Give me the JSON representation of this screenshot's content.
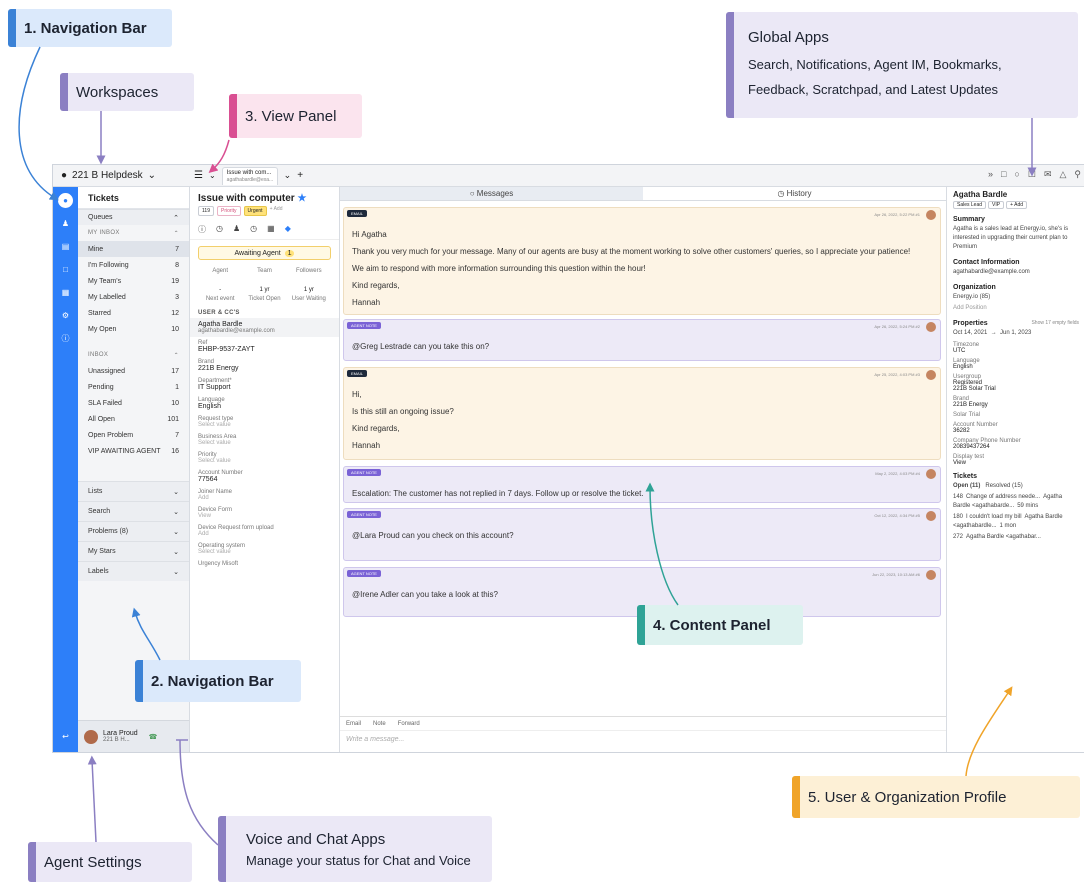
{
  "callouts": {
    "nav1": "1. Navigation Bar",
    "workspaces": "Workspaces",
    "view_panel": "3. View Panel",
    "global_title": "Global Apps",
    "global_desc1": "Search, Notifications, Agent IM, Bookmarks,",
    "global_desc2": "Feedback, Scratchpad, and Latest Updates",
    "nav2": "2. Navigation Bar",
    "content_panel": "4. Content Panel",
    "user_org": "5. User & Organization Profile",
    "agent_settings": "Agent Settings",
    "voice_title": "Voice and Chat Apps",
    "voice_desc": "Manage your status for Chat and Voice"
  },
  "app": {
    "workspace": "221 B Helpdesk",
    "tab_title": "Issue with com...",
    "tab_sub": "agathabardle@exa..."
  },
  "nav": {
    "header": "Tickets",
    "queues": "Queues",
    "my_inbox": "MY INBOX",
    "my_inbox_items": [
      {
        "label": "Mine",
        "count": "7"
      },
      {
        "label": "I'm Following",
        "count": "8"
      },
      {
        "label": "My Team's",
        "count": "19"
      },
      {
        "label": "My Labelled",
        "count": "3"
      },
      {
        "label": "Starred",
        "count": "12"
      },
      {
        "label": "My Open",
        "count": "10"
      }
    ],
    "inbox": "INBOX",
    "inbox_items": [
      {
        "label": "Unassigned",
        "count": "17"
      },
      {
        "label": "Pending",
        "count": "1"
      },
      {
        "label": "SLA Failed",
        "count": "10"
      },
      {
        "label": "All Open",
        "count": "101"
      },
      {
        "label": "Open Problem",
        "count": "7"
      },
      {
        "label": "VIP AWAITING AGENT",
        "count": "16"
      }
    ],
    "groups": [
      "Lists",
      "Search",
      "Problems (8)",
      "My Stars",
      "Labels"
    ],
    "agent_name": "Lara Proud",
    "agent_ws": "221 B H..."
  },
  "detail": {
    "title": "Issue with computer",
    "ticket_no": "119",
    "tag_priority": "Priority",
    "tag_urgent": "Urgent",
    "tag_add": "+ Add",
    "status": "Awaiting Agent",
    "status_count": "1",
    "cols": [
      "Agent",
      "Team",
      "Followers"
    ],
    "times": [
      "-",
      "1 yr",
      "1 yr"
    ],
    "time_labels": [
      "Next event",
      "Ticket Open",
      "User Waiting"
    ],
    "users_section": "USER & CC'S",
    "user_name": "Agatha Bardle",
    "user_email": "agathabardle@example.com",
    "fields": [
      {
        "label": "Ref",
        "value": "EHBP-9537-ZAYT"
      },
      {
        "label": "Brand",
        "value": "221B Energy"
      },
      {
        "label": "Department*",
        "value": "IT Support"
      },
      {
        "label": "Language",
        "value": "English"
      },
      {
        "label": "Request type",
        "value": "Select value"
      },
      {
        "label": "Business Area",
        "value": "Select value"
      },
      {
        "label": "Priority",
        "value": "Select value"
      },
      {
        "label": "Account Number",
        "value": "77564"
      },
      {
        "label": "Joiner Name",
        "value": "Add"
      },
      {
        "label": "Device Form",
        "value": "View"
      },
      {
        "label": "Device Request form upload",
        "value": "Add"
      }
    ],
    "os_label": "Operating system",
    "os_value": "Select value",
    "urgency": "Urgency Misoft"
  },
  "content": {
    "tab_messages": "Messages",
    "tab_history": "History",
    "toolbar": [
      "Delete",
      "Lock",
      "Macro",
      "Follow Up",
      "More"
    ],
    "messages": [
      {
        "kind": "EMAIL",
        "meta": "Apr 26, 2022, 5:22 PM  #1",
        "lines": [
          "Hi Agatha",
          "Thank you very much for your message. Many of our agents are busy at the moment working to solve other customers' queries, so I appreciate your patience!",
          "We aim to respond with more information surrounding this question within the hour!",
          "Kind regards,",
          "Hannah"
        ]
      },
      {
        "kind": "AGENT NOTE",
        "meta": "Apr 26, 2022, 5:24 PM  #2",
        "lines": [
          "@Greg Lestrade can you take this on?"
        ]
      },
      {
        "kind": "EMAIL",
        "meta": "Apr 25, 2022, 4:03 PM  #3",
        "lines": [
          "Hi,",
          "Is this still an ongoing issue?",
          "Kind regards,",
          "Hannah"
        ]
      },
      {
        "kind": "AGENT NOTE",
        "meta": "May 2, 2022, 4:03 PM  #4",
        "lines": [
          "Escalation: The customer has not replied in 7 days. Follow up or resolve the ticket."
        ]
      },
      {
        "kind": "AGENT NOTE",
        "meta": "Oct 12, 2022, 4:34 PM  #5",
        "lines": [
          "@Lara Proud can you check on this account?"
        ]
      },
      {
        "kind": "AGENT NOTE",
        "meta": "Jun 22, 2023, 10:13 AM  #6",
        "lines": [
          "@Irene Adler can you take a look at this?"
        ]
      }
    ],
    "composer_tabs": [
      "Email",
      "Note",
      "Forward"
    ],
    "composer_placeholder": "Write a message..."
  },
  "profile": {
    "name": "Agatha Bardle",
    "tags": [
      "Sales Lead",
      "VIP",
      "+ Add"
    ],
    "summary_title": "Summary",
    "summary": "Agatha is a sales lead at Energy.io, she's is interested in upgrading their current plan to Premium",
    "contact_title": "Contact Information",
    "email": "agathabardle@example.com",
    "org_title": "Organization",
    "org": "Energy.io (85)",
    "add_position": "Add Position",
    "props_title": "Properties",
    "show_empty": "Show 17 empty fields",
    "date_from": "Oct 14, 2021",
    "date_to": "Jun 1, 2023",
    "props": [
      {
        "label": "Timezone",
        "value": "UTC"
      },
      {
        "label": "Language",
        "value": "English"
      },
      {
        "label": "Usergroup",
        "value": "Registered"
      },
      {
        "label": "",
        "value": "221B Solar Trial"
      },
      {
        "label": "Brand",
        "value": "221B Energy"
      },
      {
        "label": "Solar Trial",
        "value": ""
      },
      {
        "label": "Account Number",
        "value": "36282"
      },
      {
        "label": "Company Phone Number",
        "value": "20839437264"
      },
      {
        "label": "Display test",
        "value": "View"
      }
    ],
    "tickets_title": "Tickets",
    "open_tab": "Open (11)",
    "resolved_tab": "Resolved (15)",
    "ticket_rows": [
      {
        "id": "148",
        "subject": "Change of address neede...",
        "who": "Agatha Bardle <agathabarde...",
        "age": "59 mins"
      },
      {
        "id": "180",
        "subject": "I couldn't load my bill",
        "who": "Agatha Bardle <agathabardle...",
        "age": "1 mon"
      },
      {
        "id": "272",
        "subject": "",
        "who": "Agatha Bardle <agathabar...",
        "age": ""
      }
    ]
  },
  "colors": {
    "rail_blue": "#2d7ff9",
    "email_bg": "#fdf4e5",
    "note_bg": "#edeaf7",
    "urgent": "#ffe27a"
  }
}
